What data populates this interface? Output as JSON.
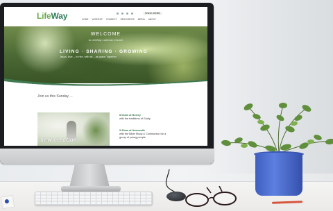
{
  "site": {
    "logo_part1": "Life",
    "logo_part2": "Way",
    "nav": [
      "HOME",
      "WORSHIP",
      "CONNECT",
      "RESOURCES",
      "MEDIA",
      "ABOUT"
    ],
    "search_label": "Search website"
  },
  "hero": {
    "welcome": "WELCOME",
    "sub": "to LifeWay Lutheran Church",
    "tag": "LIVING · SHARING · GROWING",
    "tagline": "Jesus' love – in Him, with all – as grace Together"
  },
  "join": "Join us this Sunday ...",
  "services": [
    {
      "time": "8:00am at Bexley",
      "desc": "with the traditions of Godly"
    },
    {
      "time": "9:30am at Newcastle",
      "desc": "with the Bible Study & Communion for a group of young people"
    }
  ],
  "image_caption": "new creation",
  "colors": {
    "brand": "#6aa84f",
    "brand_dark": "#2e7d5a",
    "pot": "#4a6ad0"
  }
}
